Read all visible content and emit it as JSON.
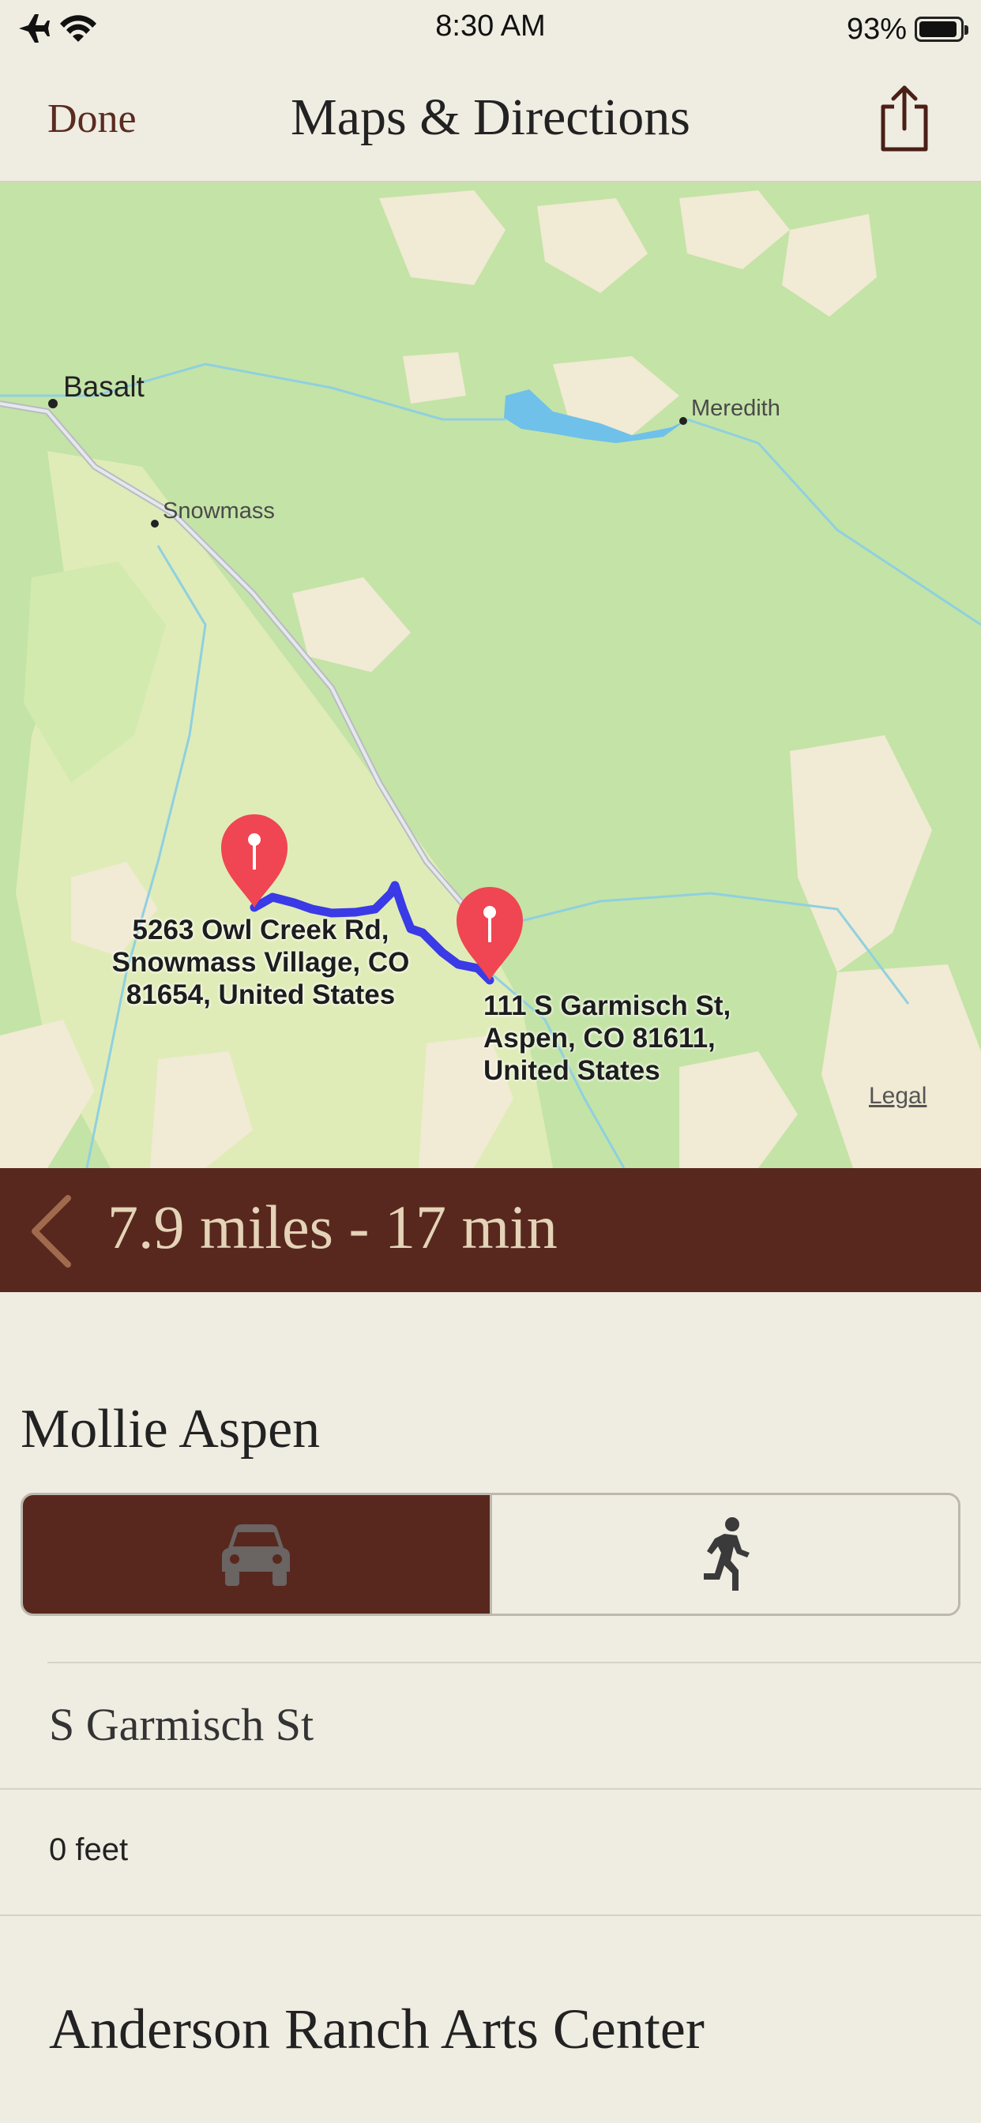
{
  "status_bar": {
    "time": "8:30 AM",
    "battery_percent": "93%",
    "battery_level": 0.93,
    "icons": [
      "airplane-icon",
      "wifi-icon",
      "battery-icon"
    ]
  },
  "nav": {
    "done_label": "Done",
    "title": "Maps & Directions",
    "share_icon": "share-icon"
  },
  "map": {
    "towns": {
      "basalt": "Basalt",
      "snowmass": "Snowmass",
      "meredith": "Meredith"
    },
    "origin": {
      "line1": "5263 Owl Creek Rd,",
      "line2": "Snowmass Village, CO",
      "line3": "81654, United States"
    },
    "destination": {
      "line1": "111 S Garmisch St,",
      "line2": "Aspen, CO  81611,",
      "line3": "United States"
    },
    "legal": "Legal",
    "route_color": "#3a3ae6",
    "pin_color": "#f04552"
  },
  "route_summary": {
    "text": "7.9 miles - 17 min",
    "back_icon": "chevron-left-icon"
  },
  "destination_name": "Mollie Aspen",
  "transport_modes": {
    "selected": "drive",
    "drive_icon": "car-icon",
    "walk_icon": "walking-icon"
  },
  "steps": [
    {
      "street": "S Garmisch St",
      "distance": "0 feet"
    }
  ],
  "next_destination": "Anderson Ranch Arts Center",
  "colors": {
    "brand_dark": "#58281e",
    "background": "#efece2",
    "route_text": "#e4d3b8"
  }
}
